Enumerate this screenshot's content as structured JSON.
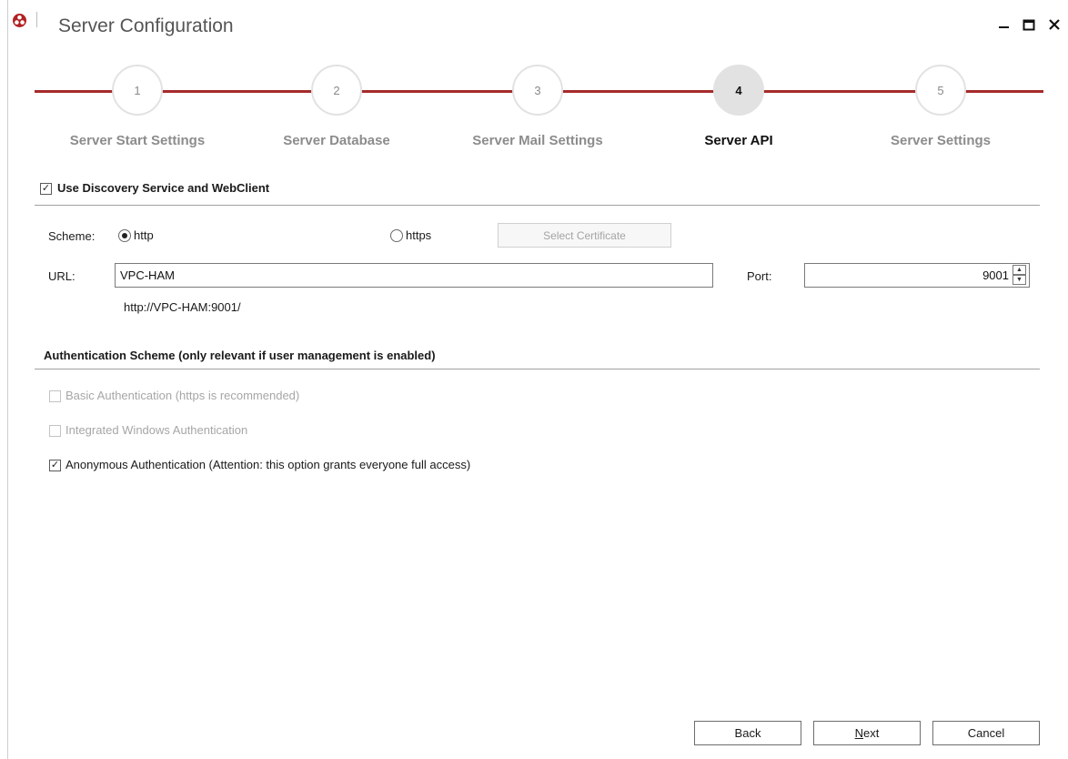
{
  "window": {
    "title": "Server Configuration",
    "icons": {
      "app": "app-logo-icon",
      "minimize": "minimize-icon",
      "maximize": "maximize-icon",
      "close": "close-icon"
    },
    "accent_color": "#a52a2a"
  },
  "wizard": {
    "current_step": 4,
    "steps": [
      {
        "number": "1",
        "label": "Server Start Settings"
      },
      {
        "number": "2",
        "label": "Server Database"
      },
      {
        "number": "3",
        "label": "Server Mail Settings"
      },
      {
        "number": "4",
        "label": "Server API"
      },
      {
        "number": "5",
        "label": "Server Settings"
      }
    ]
  },
  "discovery": {
    "label": "Use Discovery Service and WebClient",
    "checked": true
  },
  "scheme": {
    "label": "Scheme:",
    "options": [
      "http",
      "https"
    ],
    "selected": "http",
    "select_certificate_label": "Select Certificate"
  },
  "url": {
    "label": "URL:",
    "value": "VPC-HAM",
    "preview": "http://VPC-HAM:9001/"
  },
  "port": {
    "label": "Port:",
    "value": "9001"
  },
  "auth": {
    "heading": "Authentication Scheme (only relevant if user management is enabled)",
    "options": [
      {
        "label": "Basic Authentication (https is recommended)",
        "checked": false,
        "enabled": false
      },
      {
        "label": "Integrated Windows Authentication",
        "checked": false,
        "enabled": false
      },
      {
        "label": "Anonymous Authentication (Attention: this option grants everyone full access)",
        "checked": true,
        "enabled": true
      }
    ]
  },
  "footer": {
    "back": "Back",
    "next_mnemonic": "N",
    "next_rest": "ext",
    "cancel": "Cancel"
  }
}
